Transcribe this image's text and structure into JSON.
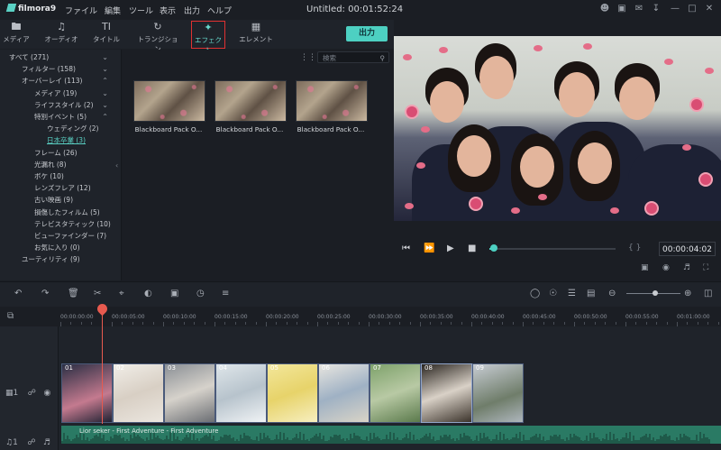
{
  "app": {
    "name": "filmora9",
    "title": "Untitled:  00:01:52:24"
  },
  "menu": [
    "ファイル",
    "編集",
    "ツール",
    "表示",
    "出力",
    "ヘルプ"
  ],
  "tabs": [
    {
      "label": "メディア",
      "icon": "folder-icon"
    },
    {
      "label": "オーディオ",
      "icon": "music-note-icon"
    },
    {
      "label": "タイトル",
      "icon": "title-text-icon"
    },
    {
      "label": "トランジション",
      "icon": "transition-icon"
    },
    {
      "label": "エフェクト",
      "icon": "effects-sparkle-icon"
    },
    {
      "label": "エレメント",
      "icon": "image-element-icon"
    }
  ],
  "export_label": "出力",
  "sidebar": {
    "items": [
      {
        "label": "すべて (271)",
        "chev": "⌄"
      },
      {
        "label": "フィルター (158)",
        "chev": "⌄"
      },
      {
        "label": "オーバーレイ (113)",
        "chev": "⌃"
      },
      {
        "label": "メディア (19)",
        "chev": "⌄"
      },
      {
        "label": "ライフスタイル (2)",
        "chev": "⌄"
      },
      {
        "label": "特別イベント (5)",
        "chev": "⌃"
      },
      {
        "label": "ウェディング (2)",
        "chev": ""
      },
      {
        "label": "日本卒業 (3)",
        "chev": ""
      },
      {
        "label": "フレーム (26)",
        "chev": ""
      },
      {
        "label": "光漏れ (8)",
        "chev": ""
      },
      {
        "label": "ボケ (10)",
        "chev": ""
      },
      {
        "label": "レンズフレア (12)",
        "chev": ""
      },
      {
        "label": "古い映画 (9)",
        "chev": ""
      },
      {
        "label": "損傷したフィルム (5)",
        "chev": ""
      },
      {
        "label": "テレビスタティック (10)",
        "chev": ""
      },
      {
        "label": "ビューファインダー (7)",
        "chev": ""
      },
      {
        "label": "お気に入り (0)",
        "chev": ""
      },
      {
        "label": "ユーティリティ (9)",
        "chev": ""
      }
    ]
  },
  "search": {
    "placeholder": "検索"
  },
  "effects": [
    {
      "label": "Blackboard Pack O..."
    },
    {
      "label": "Blackboard Pack O..."
    },
    {
      "label": "Blackboard Pack O..."
    }
  ],
  "player": {
    "timecode": "00:00:04:02",
    "progress": 0.03,
    "brackets": "{   }"
  },
  "ruler": [
    "00:00:00:00",
    "00:00:05:00",
    "00:00:10:00",
    "00:00:15:00",
    "00:00:20:00",
    "00:00:25:00",
    "00:00:30:00",
    "00:00:35:00",
    "00:00:40:00",
    "00:00:45:00",
    "00:00:50:00",
    "00:00:55:00",
    "00:01:00:00"
  ],
  "clips": [
    {
      "num": "01"
    },
    {
      "num": "02"
    },
    {
      "num": "03"
    },
    {
      "num": "04"
    },
    {
      "num": "05"
    },
    {
      "num": "06"
    },
    {
      "num": "07"
    },
    {
      "num": "08"
    },
    {
      "num": "09"
    }
  ],
  "audio": {
    "label": "Lior seker - First Adventure - First Adventure"
  },
  "tracks": {
    "video_label": "1",
    "audio_label": "1"
  },
  "colors": {
    "accent": "#4dd0c2",
    "playhead": "#e85a4f",
    "highlight_border": "#e03131",
    "audio": "#2a7a64"
  }
}
